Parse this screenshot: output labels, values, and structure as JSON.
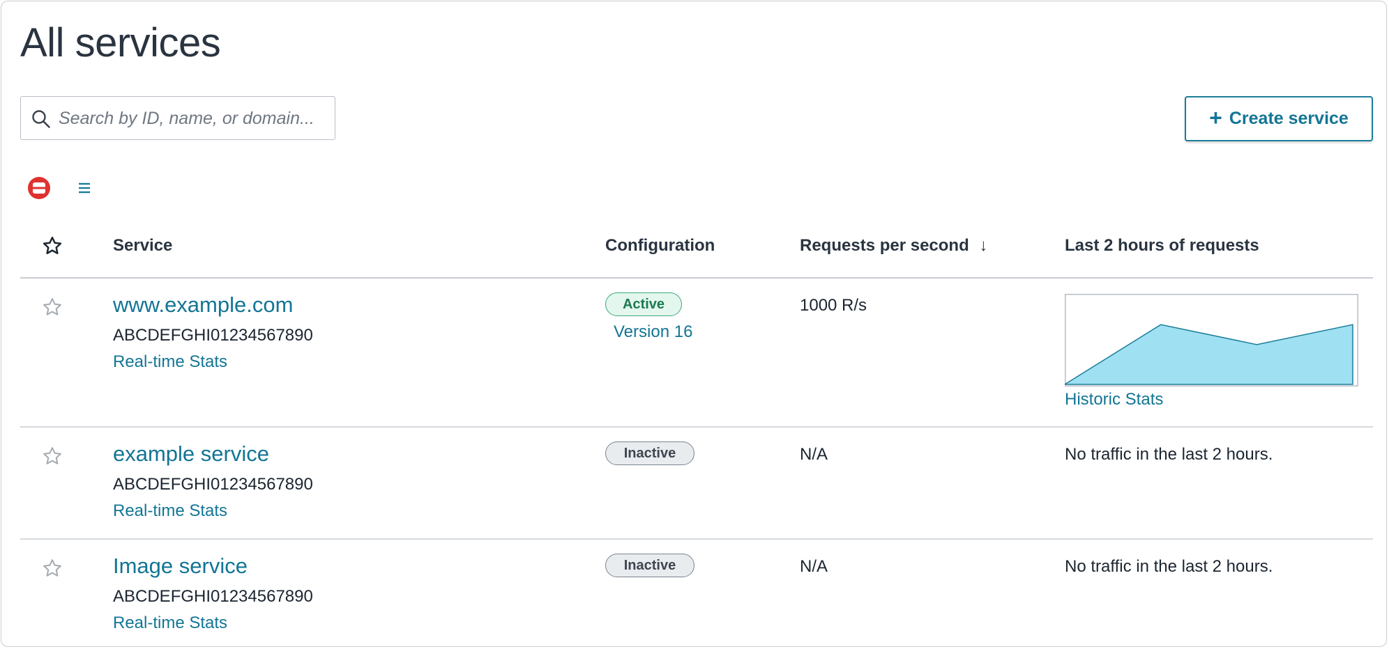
{
  "page": {
    "title": "All services"
  },
  "search": {
    "placeholder": "Search by ID, name, or domain...",
    "icon": "search-icon"
  },
  "toolbar": {
    "create_label": "Create service",
    "create_icon": "plus-icon",
    "view_grid_icon": "grid-view-icon",
    "view_list_icon": "list-view-icon"
  },
  "table": {
    "headers": {
      "favorite_icon": "star-icon",
      "service": "Service",
      "configuration": "Configuration",
      "rps": "Requests per second",
      "rps_sort": "↓",
      "history": "Last 2 hours of requests"
    },
    "rows": [
      {
        "name": "www.example.com",
        "id": "ABCDEFGHI01234567890",
        "stats_link": "Real-time Stats",
        "status": "Active",
        "version": "Version 16",
        "rps": "1000 R/s",
        "history_link": "Historic Stats",
        "traffic_text": ""
      },
      {
        "name": "example service",
        "id": "ABCDEFGHI01234567890",
        "stats_link": "Real-time Stats",
        "status": "Inactive",
        "version": "",
        "rps": "N/A",
        "history_link": "",
        "traffic_text": "No traffic in the last 2 hours."
      },
      {
        "name": "Image service",
        "id": "ABCDEFGHI01234567890",
        "stats_link": "Real-time Stats",
        "status": "Inactive",
        "version": "",
        "rps": "N/A",
        "history_link": "",
        "traffic_text": "No traffic in the last 2 hours."
      }
    ]
  },
  "chart_data": {
    "type": "area",
    "x": [
      0,
      1,
      2,
      3
    ],
    "values": [
      0,
      66,
      44,
      66
    ],
    "ylim": [
      0,
      100
    ],
    "xlabel": "",
    "ylabel": "",
    "grid": false,
    "colors": {
      "fill": "#9fe0f2",
      "stroke": "#1b7d9a",
      "border": "#b8bec6"
    }
  },
  "colors": {
    "link": "#137595",
    "accent": "#1b7d9a",
    "active_bg": "#e3f7ee",
    "active_border": "#3ba878",
    "inactive_bg": "#e9ecef",
    "danger": "#e03131"
  }
}
